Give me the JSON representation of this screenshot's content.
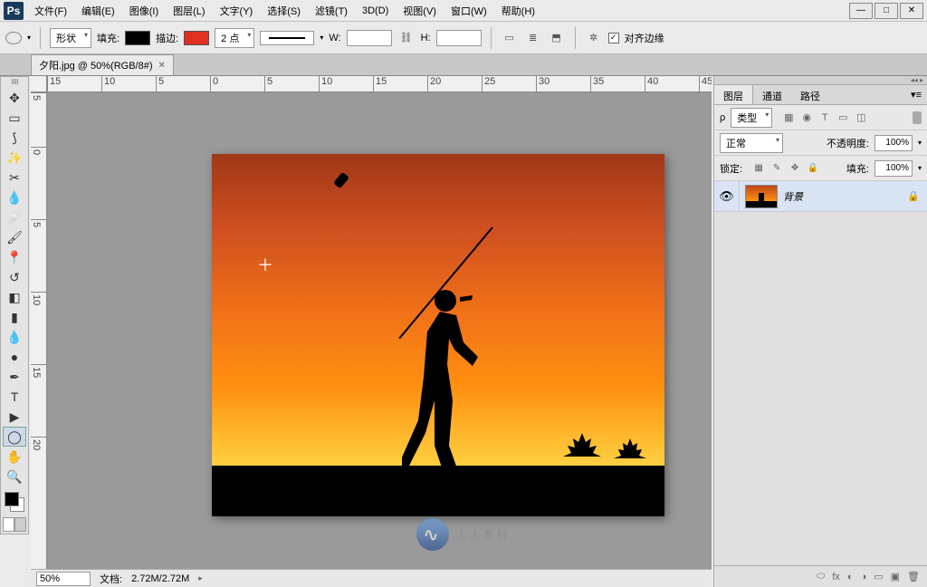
{
  "app": {
    "logo": "Ps"
  },
  "menu": [
    "文件(F)",
    "编辑(E)",
    "图像(I)",
    "图层(L)",
    "文字(Y)",
    "选择(S)",
    "滤镜(T)",
    "3D(D)",
    "视图(V)",
    "窗口(W)",
    "帮助(H)"
  ],
  "options": {
    "shape_mode": "形状",
    "fill_label": "填充:",
    "stroke_label": "描边:",
    "stroke_width": "2 点",
    "w_label": "W:",
    "w_value": "",
    "h_label": "H:",
    "h_value": "",
    "align_label": "对齐边缘",
    "align_checked": "✓",
    "fill_color": "#000000",
    "stroke_color": "#e03020"
  },
  "tab": {
    "title": "夕阳.jpg @ 50%(RGB/8#)"
  },
  "ruler_h": [
    "15",
    "10",
    "5",
    "0",
    "5",
    "10",
    "15",
    "20",
    "25",
    "30",
    "35",
    "40",
    "45"
  ],
  "ruler_v": [
    "5",
    "0",
    "5",
    "10",
    "15",
    "20"
  ],
  "panels": {
    "tabs": [
      "图层",
      "通道",
      "路径"
    ],
    "type_label": "类型",
    "blend_mode": "正常",
    "opacity_label": "不透明度:",
    "opacity_value": "100%",
    "lock_label": "锁定:",
    "fill_label": "填充:",
    "fill_value": "100%",
    "layer": {
      "name": "背景"
    },
    "filter_icons": [
      "▦",
      "◉",
      "T",
      "▭",
      "◫"
    ],
    "lock_icons": [
      "▦",
      "✎",
      "✥",
      "🔒"
    ],
    "bottom_icons": [
      "⬭",
      "fx",
      "◐",
      "◑",
      "▭",
      "▣",
      "🗑"
    ]
  },
  "status": {
    "zoom": "50%",
    "doc_label": "文档:",
    "doc_size": "2.72M/2.72M"
  },
  "watermark": "人人素材",
  "colors": {
    "fg": "#000000",
    "bg": "#ffffff"
  }
}
